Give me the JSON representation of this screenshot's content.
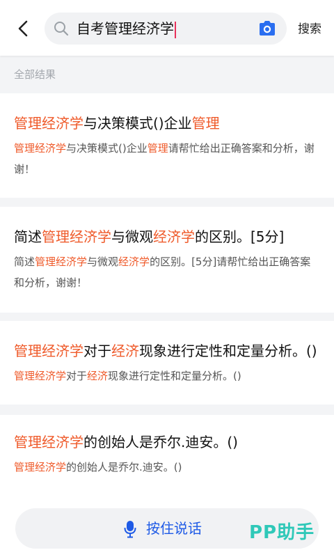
{
  "header": {
    "search_value": "自考管理经济学",
    "search_button": "搜索",
    "icons": [
      "back-arrow-icon",
      "search-icon",
      "camera-icon"
    ]
  },
  "section_title": "全部结果",
  "results": [
    {
      "title": [
        {
          "t": "管理经济学",
          "h": true
        },
        {
          "t": "与决策模式()企业",
          "h": false
        },
        {
          "t": "管理",
          "h": true
        }
      ],
      "snippet": [
        {
          "t": "管理经济学",
          "h": true
        },
        {
          "t": "与决策模式()企业",
          "h": false
        },
        {
          "t": "管理",
          "h": true
        },
        {
          "t": "请帮忙给出正确答案和分析，谢谢！",
          "h": false
        }
      ]
    },
    {
      "title": [
        {
          "t": "简述",
          "h": false
        },
        {
          "t": "管理经济学",
          "h": true
        },
        {
          "t": "与微观",
          "h": false
        },
        {
          "t": "经济学",
          "h": true
        },
        {
          "t": "的区别。[5分]",
          "h": false
        }
      ],
      "snippet": [
        {
          "t": "简述",
          "h": false
        },
        {
          "t": "管理经济学",
          "h": true
        },
        {
          "t": "与微观",
          "h": false
        },
        {
          "t": "经济学",
          "h": true
        },
        {
          "t": "的区别。[5分]请帮忙给出正确答案和分析，谢谢！",
          "h": false
        }
      ]
    },
    {
      "title": [
        {
          "t": "管理经济学",
          "h": true
        },
        {
          "t": "对于",
          "h": false
        },
        {
          "t": "经济",
          "h": true
        },
        {
          "t": "现象进行定性和定量分析。()",
          "h": false
        }
      ],
      "snippet": [
        {
          "t": "管理经济学",
          "h": true
        },
        {
          "t": "对于",
          "h": false
        },
        {
          "t": "经济",
          "h": true
        },
        {
          "t": "现象进行定性和定量分析。()",
          "h": false
        }
      ]
    },
    {
      "title": [
        {
          "t": "管理经济学",
          "h": true
        },
        {
          "t": "的创始人是乔尔.迪安。()",
          "h": false
        }
      ],
      "snippet": [
        {
          "t": "管理经济学",
          "h": true
        },
        {
          "t": "的创始人是乔尔.迪安。()",
          "h": false
        }
      ]
    }
  ],
  "bottom": {
    "voice_label": "按住说话",
    "watermark": "PP助手",
    "icons": [
      "microphone-icon"
    ]
  },
  "colors": {
    "highlight": "#ef5a2a",
    "voice_accent": "#1e5ae6",
    "camera": "#2a6ef0",
    "caret": "#e8315b",
    "watermark": "#2fc8b8"
  }
}
